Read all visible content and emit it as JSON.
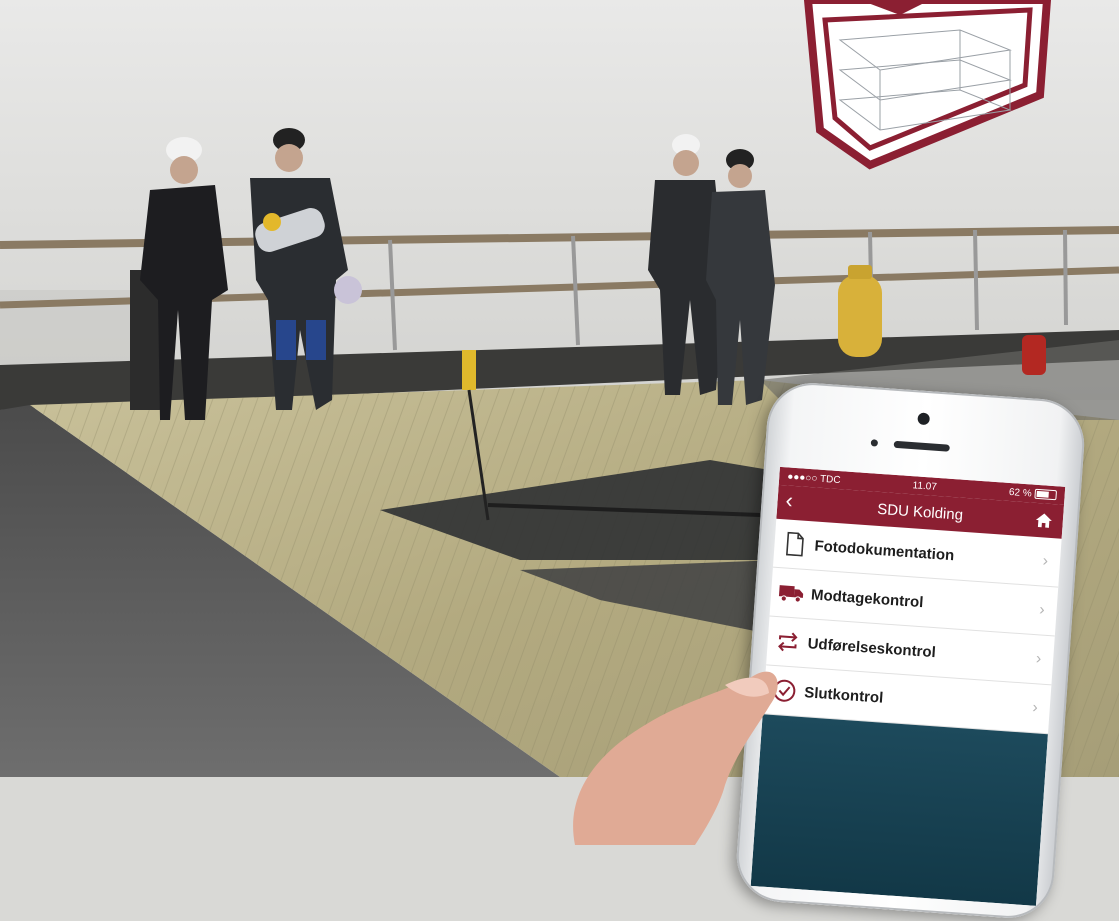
{
  "phone": {
    "status": {
      "carrier": "●●●○○ TDC",
      "time": "11.07",
      "battery": "62 %"
    },
    "nav": {
      "back_icon": "chevron-left-icon",
      "title": "SDU Kolding",
      "home_icon": "home-icon"
    },
    "menu": [
      {
        "label": "Fotodokumentation",
        "icon": "document-icon"
      },
      {
        "label": "Modtagekontrol",
        "icon": "truck-icon"
      },
      {
        "label": "Udførelseskontrol",
        "icon": "cycle-arrows-icon"
      },
      {
        "label": "Slutkontrol",
        "icon": "check-circle-icon"
      }
    ],
    "chevron": "›"
  },
  "colors": {
    "brand": "#8b1f32",
    "screen_footer": "#1d4a5c"
  }
}
